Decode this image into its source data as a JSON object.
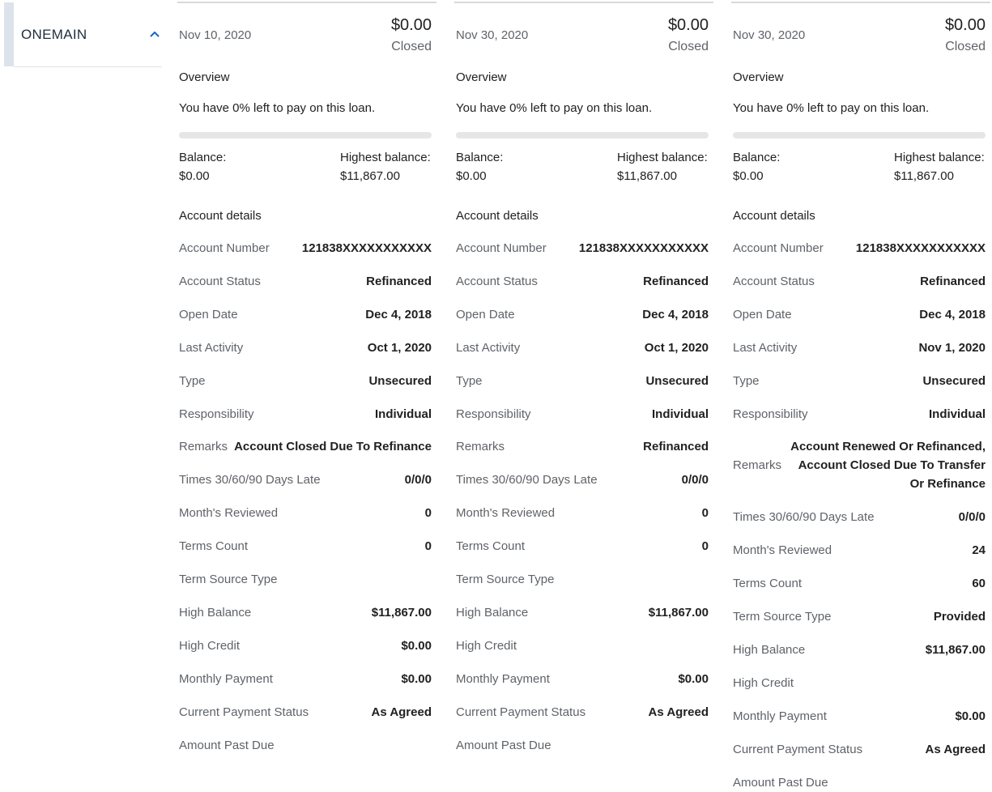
{
  "lender": {
    "name": "ONEMAIN",
    "icon": "chevron-up-icon",
    "accent": "#1565c0"
  },
  "cards": [
    {
      "date": "Nov 10, 2020",
      "amount": "$0.00",
      "status": "Closed",
      "overview_heading": "Overview",
      "overview_text": "You have 0% left to pay on this loan.",
      "progress_remaining_percent": 0,
      "balance_label": "Balance:",
      "balance_value": "$0.00",
      "highest_label": "Highest balance:",
      "highest_value": "$11,867.00",
      "details_heading": "Account details",
      "rows": [
        {
          "label": "Account Number",
          "value": "121838XXXXXXXXXXX"
        },
        {
          "label": "Account Status",
          "value": "Refinanced"
        },
        {
          "label": "Open Date",
          "value": "Dec 4, 2018"
        },
        {
          "label": "Last Activity",
          "value": "Oct 1, 2020"
        },
        {
          "label": "Type",
          "value": "Unsecured"
        },
        {
          "label": "Responsibility",
          "value": "Individual"
        },
        {
          "label": "Remarks",
          "value": "Account Closed Due To Refinance"
        },
        {
          "label": "Times 30/60/90 Days Late",
          "value": "0/0/0"
        },
        {
          "label": "Month's Reviewed",
          "value": "0"
        },
        {
          "label": "Terms Count",
          "value": "0"
        },
        {
          "label": "Term Source Type",
          "value": ""
        },
        {
          "label": "High Balance",
          "value": "$11,867.00"
        },
        {
          "label": "High Credit",
          "value": "$0.00"
        },
        {
          "label": "Monthly Payment",
          "value": "$0.00"
        },
        {
          "label": "Current Payment Status",
          "value": "As Agreed"
        },
        {
          "label": "Amount Past Due",
          "value": ""
        }
      ]
    },
    {
      "date": "Nov 30, 2020",
      "amount": "$0.00",
      "status": "Closed",
      "overview_heading": "Overview",
      "overview_text": "You have 0% left to pay on this loan.",
      "progress_remaining_percent": 0,
      "balance_label": "Balance:",
      "balance_value": "$0.00",
      "highest_label": "Highest balance:",
      "highest_value": "$11,867.00",
      "details_heading": "Account details",
      "rows": [
        {
          "label": "Account Number",
          "value": "121838XXXXXXXXXXX"
        },
        {
          "label": "Account Status",
          "value": "Refinanced"
        },
        {
          "label": "Open Date",
          "value": "Dec 4, 2018"
        },
        {
          "label": "Last Activity",
          "value": "Oct 1, 2020"
        },
        {
          "label": "Type",
          "value": "Unsecured"
        },
        {
          "label": "Responsibility",
          "value": "Individual"
        },
        {
          "label": "Remarks",
          "value": "Refinanced"
        },
        {
          "label": "Times 30/60/90 Days Late",
          "value": "0/0/0"
        },
        {
          "label": "Month's Reviewed",
          "value": "0"
        },
        {
          "label": "Terms Count",
          "value": "0"
        },
        {
          "label": "Term Source Type",
          "value": ""
        },
        {
          "label": "High Balance",
          "value": "$11,867.00"
        },
        {
          "label": "High Credit",
          "value": ""
        },
        {
          "label": "Monthly Payment",
          "value": "$0.00"
        },
        {
          "label": "Current Payment Status",
          "value": "As Agreed"
        },
        {
          "label": "Amount Past Due",
          "value": ""
        }
      ]
    },
    {
      "date": "Nov 30, 2020",
      "amount": "$0.00",
      "status": "Closed",
      "overview_heading": "Overview",
      "overview_text": "You have 0% left to pay on this loan.",
      "progress_remaining_percent": 0,
      "balance_label": "Balance:",
      "balance_value": "$0.00",
      "highest_label": "Highest balance:",
      "highest_value": "$11,867.00",
      "details_heading": "Account details",
      "rows": [
        {
          "label": "Account Number",
          "value": "121838XXXXXXXXXXX"
        },
        {
          "label": "Account Status",
          "value": "Refinanced"
        },
        {
          "label": "Open Date",
          "value": "Dec 4, 2018"
        },
        {
          "label": "Last Activity",
          "value": "Nov 1, 2020"
        },
        {
          "label": "Type",
          "value": "Unsecured"
        },
        {
          "label": "Responsibility",
          "value": "Individual"
        },
        {
          "label": "Remarks",
          "value": "Account Renewed Or Refinanced, Account Closed Due To Transfer Or Refinance"
        },
        {
          "label": "Times 30/60/90 Days Late",
          "value": "0/0/0"
        },
        {
          "label": "Month's Reviewed",
          "value": "24"
        },
        {
          "label": "Terms Count",
          "value": "60"
        },
        {
          "label": "Term Source Type",
          "value": "Provided"
        },
        {
          "label": "High Balance",
          "value": "$11,867.00"
        },
        {
          "label": "High Credit",
          "value": ""
        },
        {
          "label": "Monthly Payment",
          "value": "$0.00"
        },
        {
          "label": "Current Payment Status",
          "value": "As Agreed"
        },
        {
          "label": "Amount Past Due",
          "value": ""
        }
      ]
    }
  ]
}
